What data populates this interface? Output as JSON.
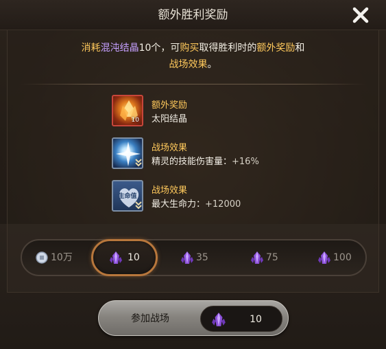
{
  "dialog": {
    "title": "额外胜利奖励",
    "close_icon": "close-icon"
  },
  "description": {
    "part1": "消耗",
    "item_name": "混沌结晶",
    "part2": "10个，可",
    "buy": "购买",
    "part3": "取得胜利时的",
    "extra_reward": "额外奖励",
    "part4": "和",
    "battle_effect": "战场效果",
    "part5": "。"
  },
  "rewards": [
    {
      "title": "额外奖励",
      "desc": "太阳结晶",
      "icon": "sun-crystal-icon",
      "qty": "10"
    },
    {
      "title": "战场效果",
      "desc": "精灵的技能伤害量：",
      "value": "+16%",
      "icon": "skill-damage-icon"
    },
    {
      "title": "战场效果",
      "desc": "最大生命力：",
      "value": "+12000",
      "icon": "max-hp-icon",
      "icon_text": "生命值"
    }
  ],
  "options": [
    {
      "label": "10万",
      "icon": "silver-coin-icon",
      "selected": false
    },
    {
      "label": "10",
      "icon": "chaos-crystal-icon",
      "selected": true
    },
    {
      "label": "35",
      "icon": "chaos-crystal-icon",
      "selected": false
    },
    {
      "label": "75",
      "icon": "chaos-crystal-icon",
      "selected": false
    },
    {
      "label": "100",
      "icon": "chaos-crystal-icon",
      "selected": false
    }
  ],
  "join": {
    "label": "参加战场",
    "cost": "10",
    "cost_icon": "chaos-crystal-icon"
  },
  "colors": {
    "highlight_purple": "#c6a0ff",
    "highlight_orange": "#ffc95c",
    "selected_ring": "#b8773c"
  }
}
